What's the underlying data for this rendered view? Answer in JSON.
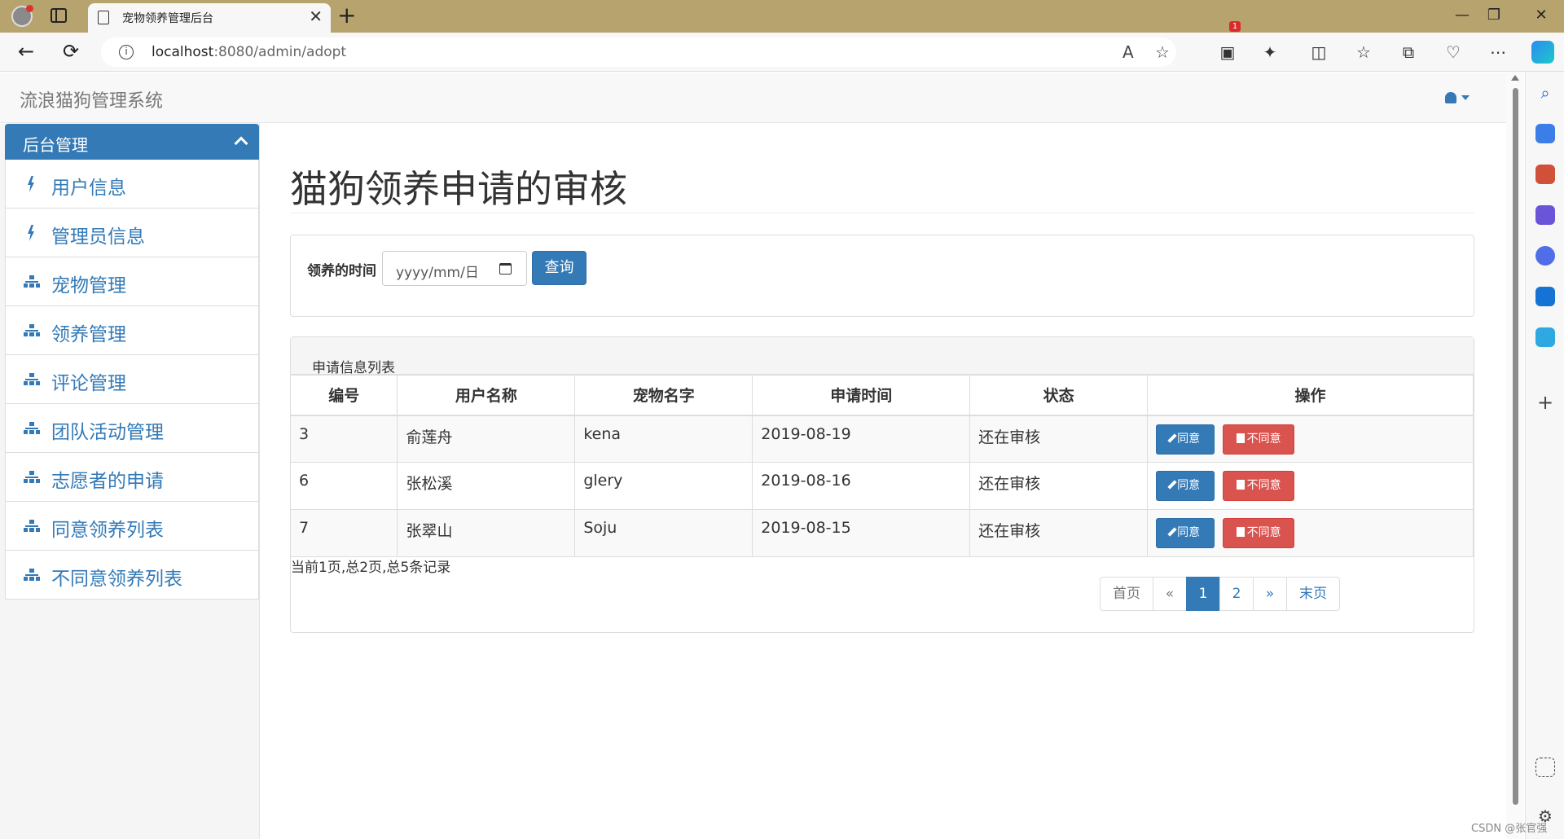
{
  "browser": {
    "tab_title": "宠物领养管理后台",
    "tab_close": "✕",
    "new_tab": "+",
    "url_host": "localhost",
    "url_rest": ":8080/admin/adopt",
    "window_controls": [
      "—",
      "❐",
      "✕"
    ]
  },
  "app": {
    "brand": "流浪猫狗管理系统"
  },
  "sidebar": {
    "header": "后台管理",
    "items": [
      {
        "label": "用户信息",
        "icon": "bolt-icon"
      },
      {
        "label": "管理员信息",
        "icon": "bolt-icon"
      },
      {
        "label": "宠物管理",
        "icon": "sitemap-icon"
      },
      {
        "label": "领养管理",
        "icon": "sitemap-icon"
      },
      {
        "label": "评论管理",
        "icon": "sitemap-icon"
      },
      {
        "label": "团队活动管理",
        "icon": "sitemap-icon"
      },
      {
        "label": "志愿者的申请",
        "icon": "sitemap-icon"
      },
      {
        "label": "同意领养列表",
        "icon": "sitemap-icon"
      },
      {
        "label": "不同意领养列表",
        "icon": "sitemap-icon"
      }
    ]
  },
  "main": {
    "title": "猫狗领养申请的审核",
    "search": {
      "label": "领养的时间",
      "date_value": "yyyy/mm/日",
      "button": "查询"
    },
    "table": {
      "heading": "申请信息列表",
      "columns": [
        "编号",
        "用户名称",
        "宠物名字",
        "申请时间",
        "状态",
        "操作"
      ],
      "rows": [
        {
          "id": "3",
          "user": "俞莲舟",
          "pet": "kena",
          "date": "2019-08-19",
          "status": "还在审核"
        },
        {
          "id": "6",
          "user": "张松溪",
          "pet": "glery",
          "date": "2019-08-16",
          "status": "还在审核"
        },
        {
          "id": "7",
          "user": "张翠山",
          "pet": "Soju",
          "date": "2019-08-15",
          "status": "还在审核"
        }
      ],
      "agree_label": "同意",
      "reject_label": "不同意"
    },
    "page_info": "当前1页,总2页,总5条记录",
    "pagination": [
      "首页",
      "«",
      "1",
      "2",
      "»",
      "末页"
    ],
    "active_page": "1"
  },
  "watermark": "CSDN @张官强",
  "colors": {
    "primary": "#337ab7",
    "danger": "#d9534f",
    "titlebar": "#b7a36e"
  }
}
